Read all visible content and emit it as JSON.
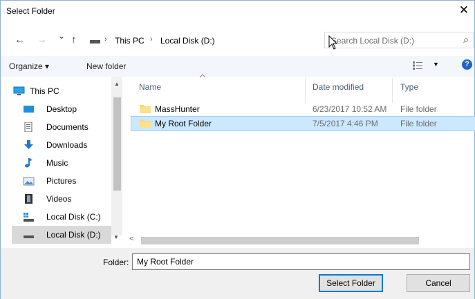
{
  "window": {
    "title": "Select Folder",
    "close_glyph": "✕"
  },
  "nav": {
    "back_glyph": "←",
    "forward_glyph": "→",
    "recent_glyph": "⌄",
    "up_glyph": "↑",
    "crumb_sep": "›",
    "breadcrumb": [
      "This PC",
      "Local Disk (D:)"
    ],
    "dropdown_glyph": "⌄",
    "refresh_glyph": "↻",
    "search_placeholder": "Search Local Disk (D:)",
    "search_icon_glyph": "⌕"
  },
  "toolbar": {
    "organize": "Organize ▾",
    "new_folder": "New folder",
    "view_dd": "▼",
    "help": "?"
  },
  "sidebar": {
    "items": [
      {
        "label": "This PC",
        "icon": "monitor-icon"
      },
      {
        "label": "Desktop",
        "icon": "desktop-icon"
      },
      {
        "label": "Documents",
        "icon": "documents-icon"
      },
      {
        "label": "Downloads",
        "icon": "download-arrow-icon"
      },
      {
        "label": "Music",
        "icon": "music-note-icon"
      },
      {
        "label": "Pictures",
        "icon": "pictures-icon"
      },
      {
        "label": "Videos",
        "icon": "film-icon"
      },
      {
        "label": "Local Disk (C:)",
        "icon": "windows-drive-icon"
      },
      {
        "label": "Local Disk (D:)",
        "icon": "drive-icon",
        "selected": true
      }
    ]
  },
  "columns": {
    "name": "Name",
    "date": "Date modified",
    "type": "Type"
  },
  "files": [
    {
      "name": "MassHunter",
      "date": "6/23/2017 10:52 AM",
      "type": "File folder",
      "selected": false
    },
    {
      "name": "My Root Folder",
      "date": "7/5/2017 4:46 PM",
      "type": "File folder",
      "selected": true
    }
  ],
  "footer": {
    "folder_label": "Folder:",
    "folder_value": "My Root Folder",
    "select_button": "Select Folder",
    "cancel_button": "Cancel"
  },
  "scroll": {
    "up": "▲",
    "down": "▼",
    "left": "<"
  },
  "colors": {
    "selection": "#cce8ff",
    "accent": "#0078d7",
    "folder": "#f8d775",
    "help": "#1e63c9"
  }
}
